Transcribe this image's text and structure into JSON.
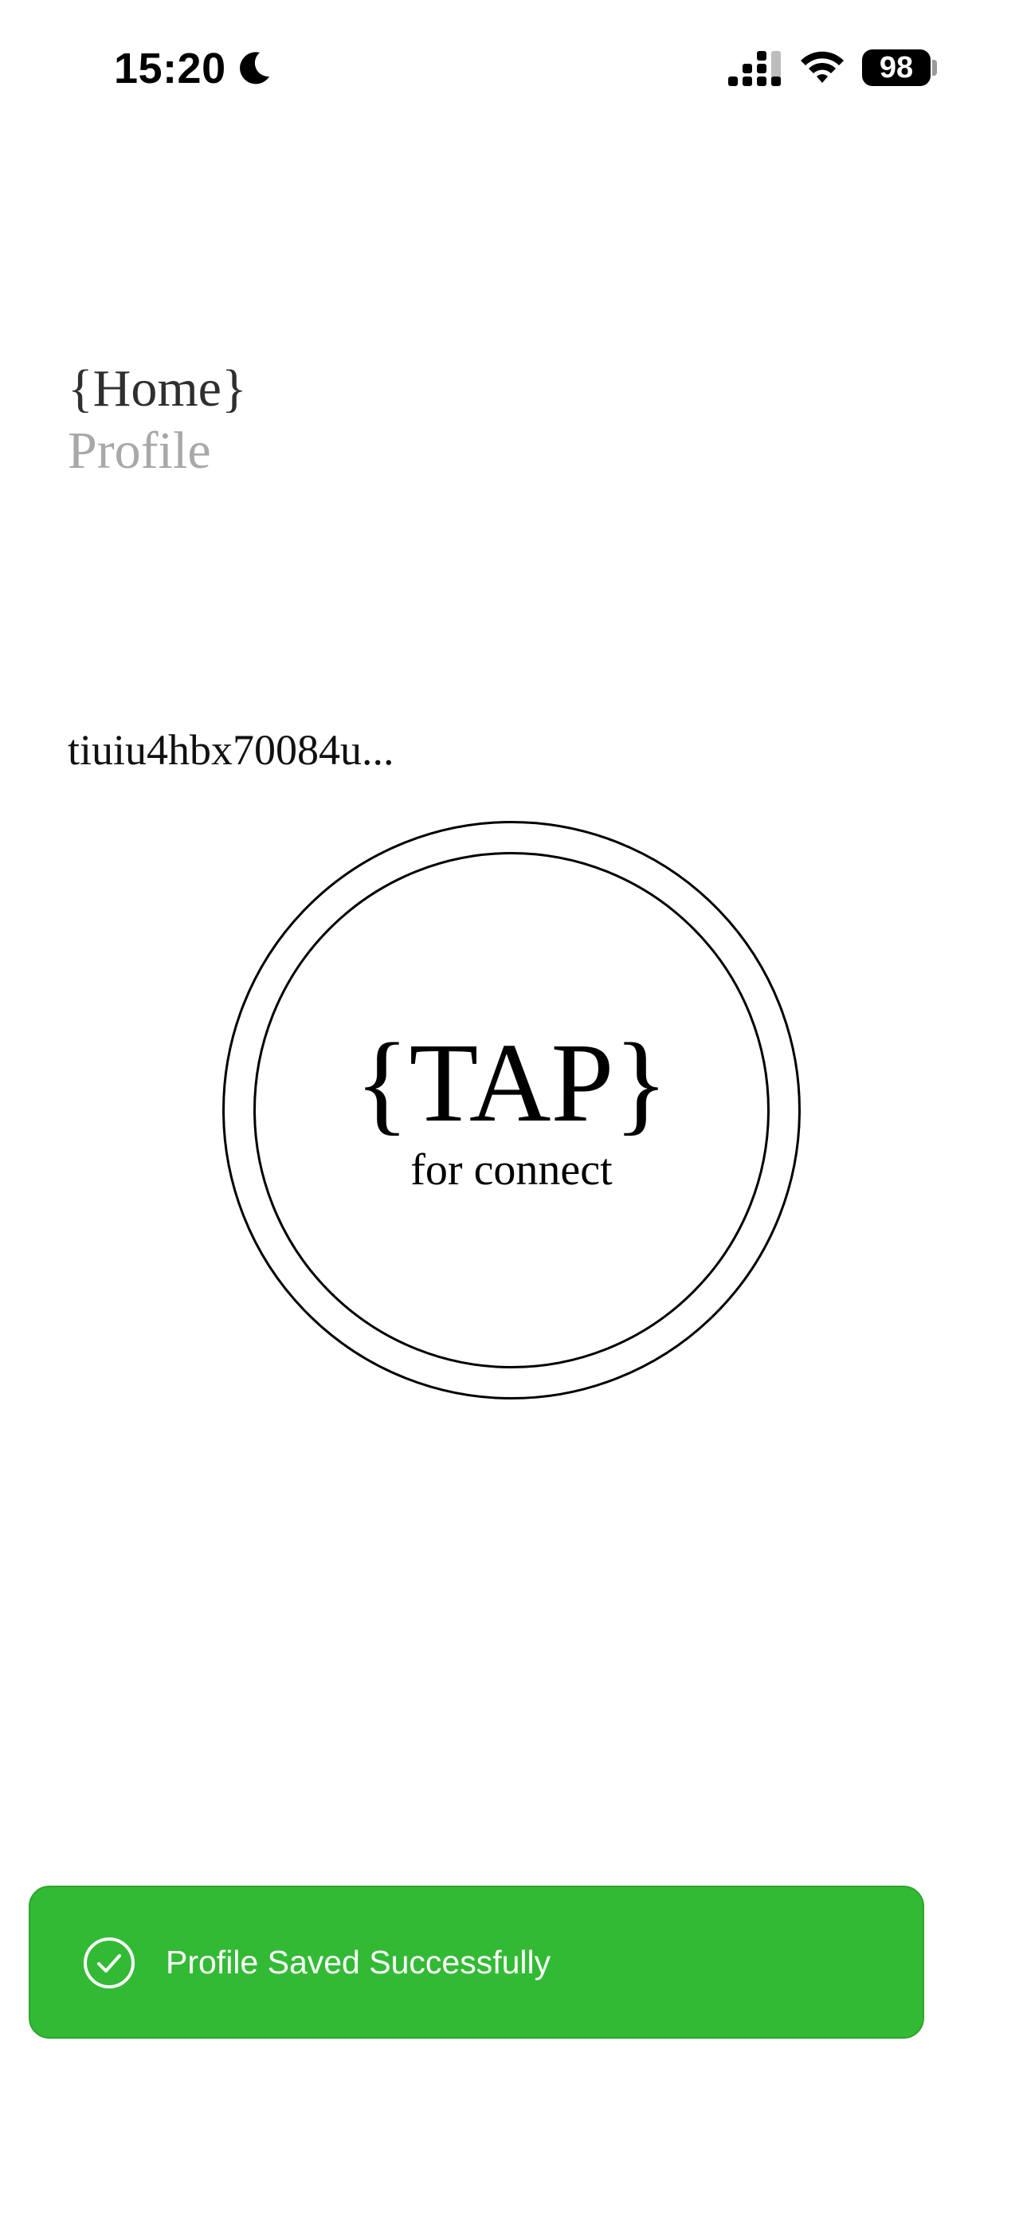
{
  "status_bar": {
    "time": "15:20",
    "battery_level": "98",
    "moon_icon": "moon-icon",
    "signal_icon": "cellular-signal-icon",
    "wifi_icon": "wifi-icon"
  },
  "nav": {
    "home_label": "{Home}",
    "profile_label": "Profile"
  },
  "address": "tiuiu4hbx70084u...",
  "tap": {
    "label": "{TAP}",
    "sublabel": "for connect"
  },
  "toast": {
    "message": "Profile Saved Successfully",
    "icon": "check-circle-icon",
    "color": "#33ba35"
  }
}
